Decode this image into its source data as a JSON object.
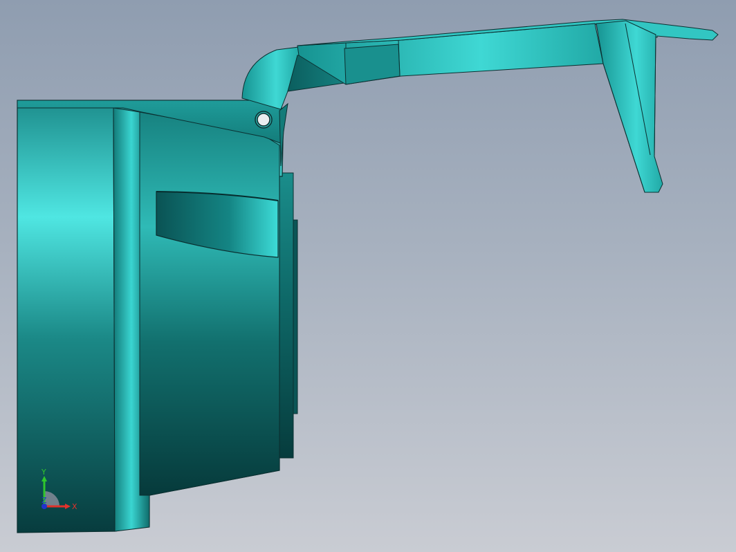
{
  "viewport": {
    "background_top": "#8f9db0",
    "background_bottom": "#c9ccd3"
  },
  "model": {
    "body_color": "#2aa6a3",
    "highlight_color": "#4fe6e2",
    "shadow_color": "#0a4f50",
    "edge_color": "#0b2f30"
  },
  "triad": {
    "x_label": "X",
    "y_label": "Y",
    "z_label": "Z",
    "x_color": "#e0322b",
    "y_color": "#2fc72c",
    "z_color": "#2233cc"
  }
}
